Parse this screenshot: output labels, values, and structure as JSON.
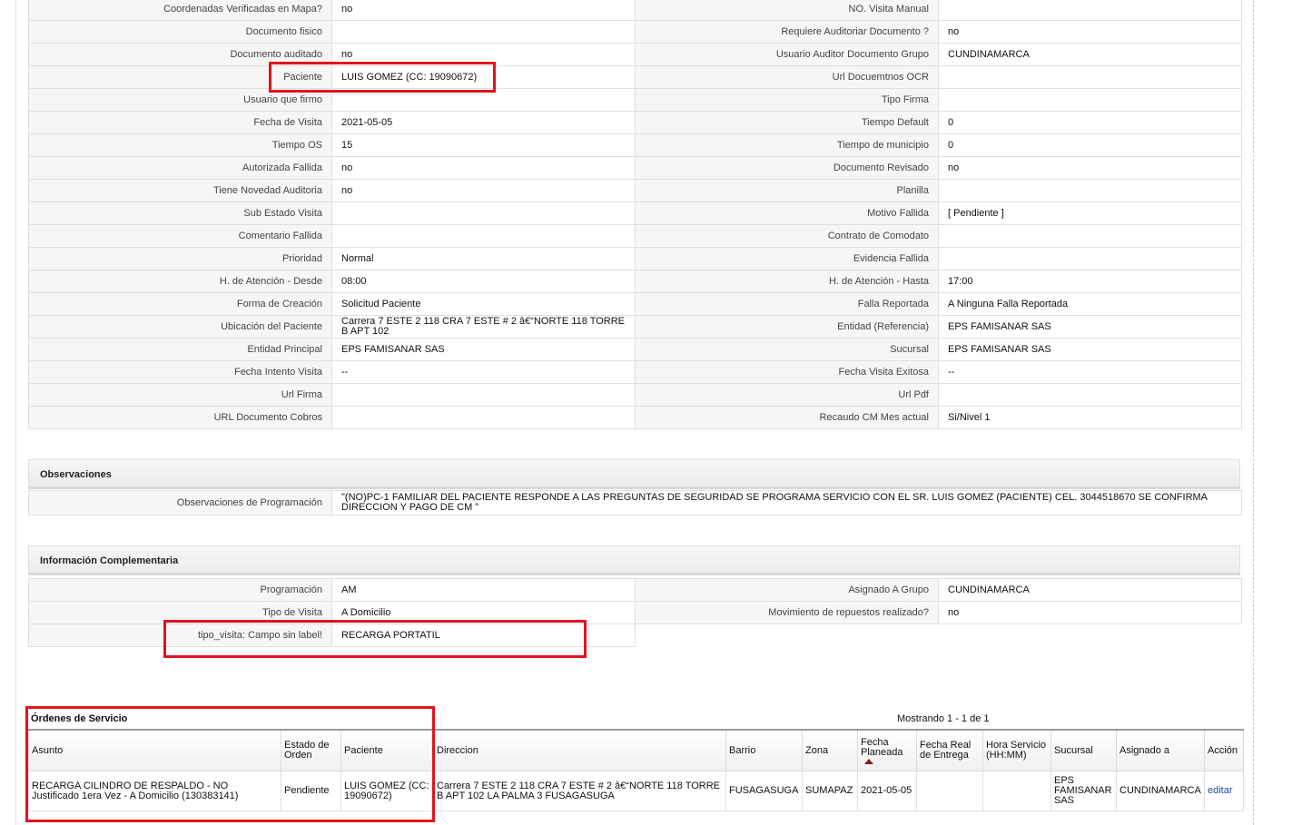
{
  "details": {
    "rows": [
      {
        "l1": "Coordenadas Verificadas en Mapa?",
        "v1": "no",
        "l2": "NO. Visita Manual",
        "v2": ""
      },
      {
        "l1": "Documento fisico",
        "v1": "",
        "l2": "Requiere Auditoriar Documento ?",
        "v2": "no"
      },
      {
        "l1": "Documento auditado",
        "v1": "no",
        "l2": "Usuario Auditor Documento Grupo",
        "v2": "CUNDINAMARCA"
      },
      {
        "l1": "Paciente",
        "v1": "LUIS GOMEZ (CC: 19090672)",
        "l2": "Url Docuemtnos OCR",
        "v2": ""
      },
      {
        "l1": "Usuario que firmo",
        "v1": "",
        "l2": "Tipo Firma",
        "v2": ""
      },
      {
        "l1": "Fecha de Visita",
        "v1": "2021-05-05",
        "l2": "Tiempo Default",
        "v2": "0"
      },
      {
        "l1": "Tiempo OS",
        "v1": "15",
        "l2": "Tiempo de municipio",
        "v2": "0"
      },
      {
        "l1": "Autorizada Fallida",
        "v1": "no",
        "l2": "Documento Revisado",
        "v2": "no"
      },
      {
        "l1": "Tiene Novedad Auditoria",
        "v1": "no",
        "l2": "Planilla",
        "v2": ""
      },
      {
        "l1": "Sub Estado Visita",
        "v1": "",
        "l2": "Motivo Fallida",
        "v2": "[ Pendiente ]"
      },
      {
        "l1": "Comentario Fallida",
        "v1": "",
        "l2": "Contrato de Comodato",
        "v2": ""
      },
      {
        "l1": "Prioridad",
        "v1": "Normal",
        "l2": "Evidencia Fallida",
        "v2": ""
      },
      {
        "l1": "H. de Atención - Desde",
        "v1": "08:00",
        "l2": "H. de Atención - Hasta",
        "v2": "17:00"
      },
      {
        "l1": "Forma de Creación",
        "v1": "Solicitud Paciente",
        "l2": "Falla Reportada",
        "v2": "A Ninguna Falla Reportada"
      },
      {
        "l1": "Ubicación del Paciente",
        "v1": "Carrera 7 ESTE 2 118 CRA 7 ESTE # 2 â€“NORTE 118 TORRE B APT 102",
        "l2": "Entidad (Referencia)",
        "v2": "EPS FAMISANAR SAS"
      },
      {
        "l1": "Entidad Principal",
        "v1": "EPS FAMISANAR SAS",
        "l2": "Sucursal",
        "v2": "EPS FAMISANAR SAS"
      },
      {
        "l1": "Fecha Intento Visita",
        "v1": "--",
        "l2": "Fecha Visita Exitosa",
        "v2": "--"
      },
      {
        "l1": "Url Firma",
        "v1": "",
        "l2": "Url Pdf",
        "v2": ""
      },
      {
        "l1": "URL Documento Cobros",
        "v1": "",
        "l2": "Recaudo CM Mes actual",
        "v2": "Si/Nivel 1"
      }
    ]
  },
  "observaciones": {
    "title": "Observaciones",
    "label": "Observaciones de Programación",
    "value": "\"(NO)PC-1 FAMILIAR DEL PACIENTE RESPONDE A LAS PREGUNTAS DE SEGURIDAD SE PROGRAMA SERVICIO CON EL SR. LUIS GOMEZ (PACIENTE) CEL. 3044518670 SE CONFIRMA DIRECCION Y PAGO DE CM \""
  },
  "complementaria": {
    "title": "Información Complementaria",
    "rows": [
      {
        "l1": "Programación",
        "v1": "AM",
        "l2": "Asignado A Grupo",
        "v2": "CUNDINAMARCA"
      },
      {
        "l1": "Tipo de Visita",
        "v1": "A Domicilio",
        "l2": "Movimiento de repuestos realizado?",
        "v2": "no"
      },
      {
        "l1": "tipo_visita: Campo sin label!",
        "v1": "RECARGA PORTATIL"
      }
    ]
  },
  "orders": {
    "title": "Órdenes de Servicio",
    "count_text": "Mostrando 1 - 1 de 1",
    "headers": [
      "Asunto",
      "Estado de Orden",
      "Paciente",
      "Direccion",
      "Barrio",
      "Zona",
      "Fecha Planeada",
      "Fecha Real de Entrega",
      "Hora Servicio (HH:MM)",
      "Sucursal",
      "Asignado a",
      "Acción"
    ],
    "rows": [
      [
        "RECARGA CILINDRO DE RESPALDO - NO Justificado 1era Vez - A Domicilio (130383141)",
        "Pendiente",
        "LUIS GOMEZ (CC: 19090672)",
        "Carrera 7 ESTE 2 118 CRA 7 ESTE # 2 â€“NORTE 118 TORRE B APT 102 LA PALMA 3 FUSAGASUGA",
        "FUSAGASUGA",
        "SUMAPAZ",
        "2021-05-05",
        "",
        "",
        "EPS FAMISANAR SAS",
        "CUNDINAMARCA",
        "editar"
      ]
    ]
  },
  "colors": {
    "highlight": "#e0141e",
    "sort_arrow": "#8b1a1a",
    "link": "#1a4d9c"
  }
}
